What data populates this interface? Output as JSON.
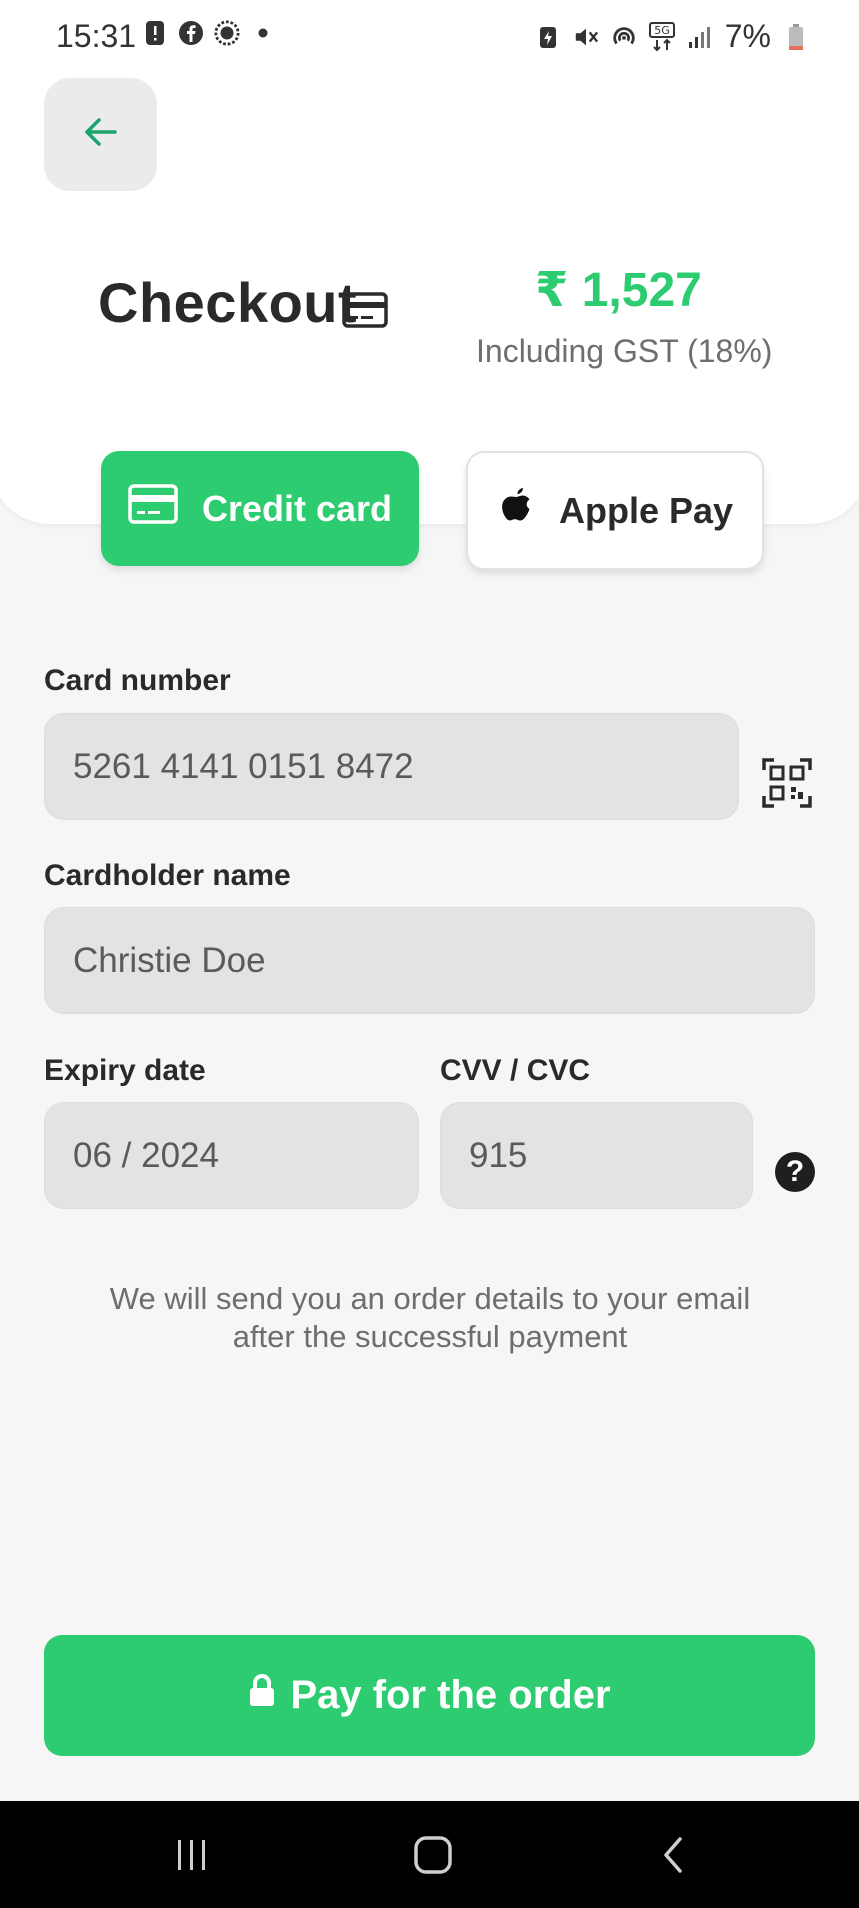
{
  "status_bar": {
    "time": "15:31",
    "battery": "7%",
    "left_icons": [
      "alert-icon",
      "facebook-icon",
      "messenger-icon",
      "dot-icon"
    ],
    "right_icons": [
      "battery-saver-icon",
      "mute-icon",
      "hotspot-icon",
      "5g-icon",
      "signal-icon",
      "battery-icon"
    ]
  },
  "header": {
    "title": "Checkout",
    "amount": "₹ 1,527",
    "gst_note": "Including GST (18%)"
  },
  "tabs": {
    "credit_card": "Credit card",
    "apple_pay": "Apple Pay",
    "selected": "credit_card"
  },
  "form": {
    "card_number_label": "Card number",
    "card_number_value": "5261 4141 0151 8472",
    "cardholder_label": "Cardholder name",
    "cardholder_value": "Christie Doe",
    "expiry_label": "Expiry date",
    "expiry_value": "06 / 2024",
    "cvv_label": "CVV / CVC",
    "cvv_value": "915"
  },
  "note": "We will send you an order details to your email after the successful payment",
  "pay_button": "Pay for the order",
  "colors": {
    "accent": "#2ecc71",
    "back_arrow": "#1aa36a",
    "background": "#f6f6f7"
  }
}
